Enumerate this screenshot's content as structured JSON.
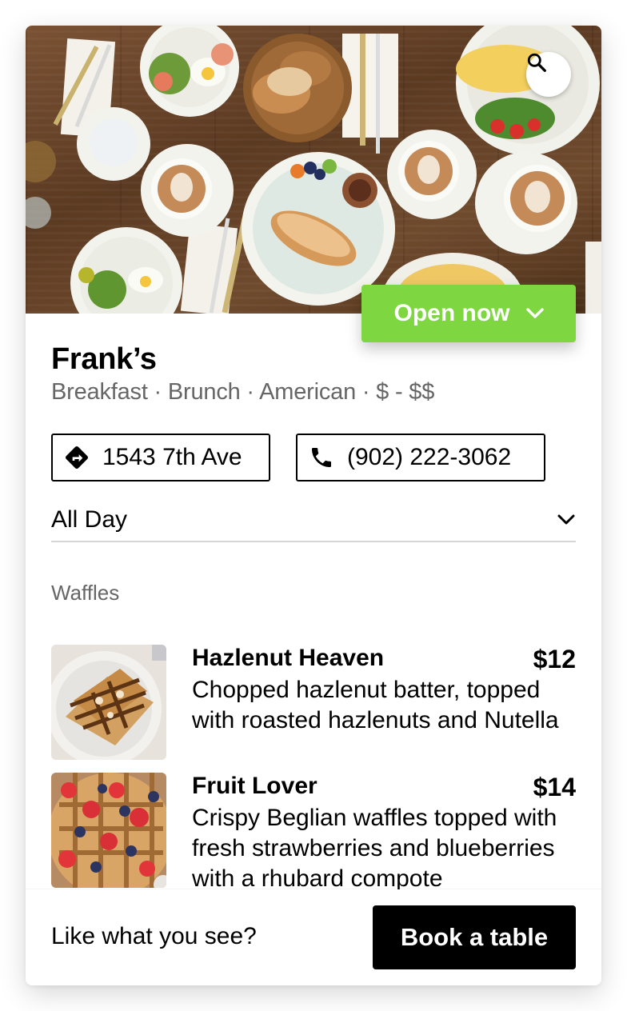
{
  "hero": {
    "image": "breakfast-table-photo",
    "search_icon": "search-icon"
  },
  "status": {
    "label": "Open now",
    "accent": "#7ed640"
  },
  "restaurant": {
    "name": "Frank’s",
    "tags": "Breakfast · Brunch · American · $ - $$",
    "address": "1543 7th Ave",
    "phone": "(902) 222-3062"
  },
  "menu": {
    "selected": "All Day",
    "section": "Waffles",
    "items": [
      {
        "name": "Hazlenut Heaven",
        "price": "$12",
        "description": "Chopped hazlenut batter, topped with roasted hazlenuts and Nutella",
        "image": "hazelnut-waffle-photo"
      },
      {
        "name": "Fruit Lover",
        "price": "$14",
        "description": "Crispy Beglian waffles topped with fresh strawberries and blueberries with a rhubard compote",
        "image": "berry-waffle-photo"
      }
    ]
  },
  "footer": {
    "prompt": "Like what you see?",
    "cta": "Book a table"
  },
  "colors": {
    "text": "#000000",
    "muted": "#666666",
    "divider": "#d6d6d6",
    "cta_bg": "#000000"
  }
}
